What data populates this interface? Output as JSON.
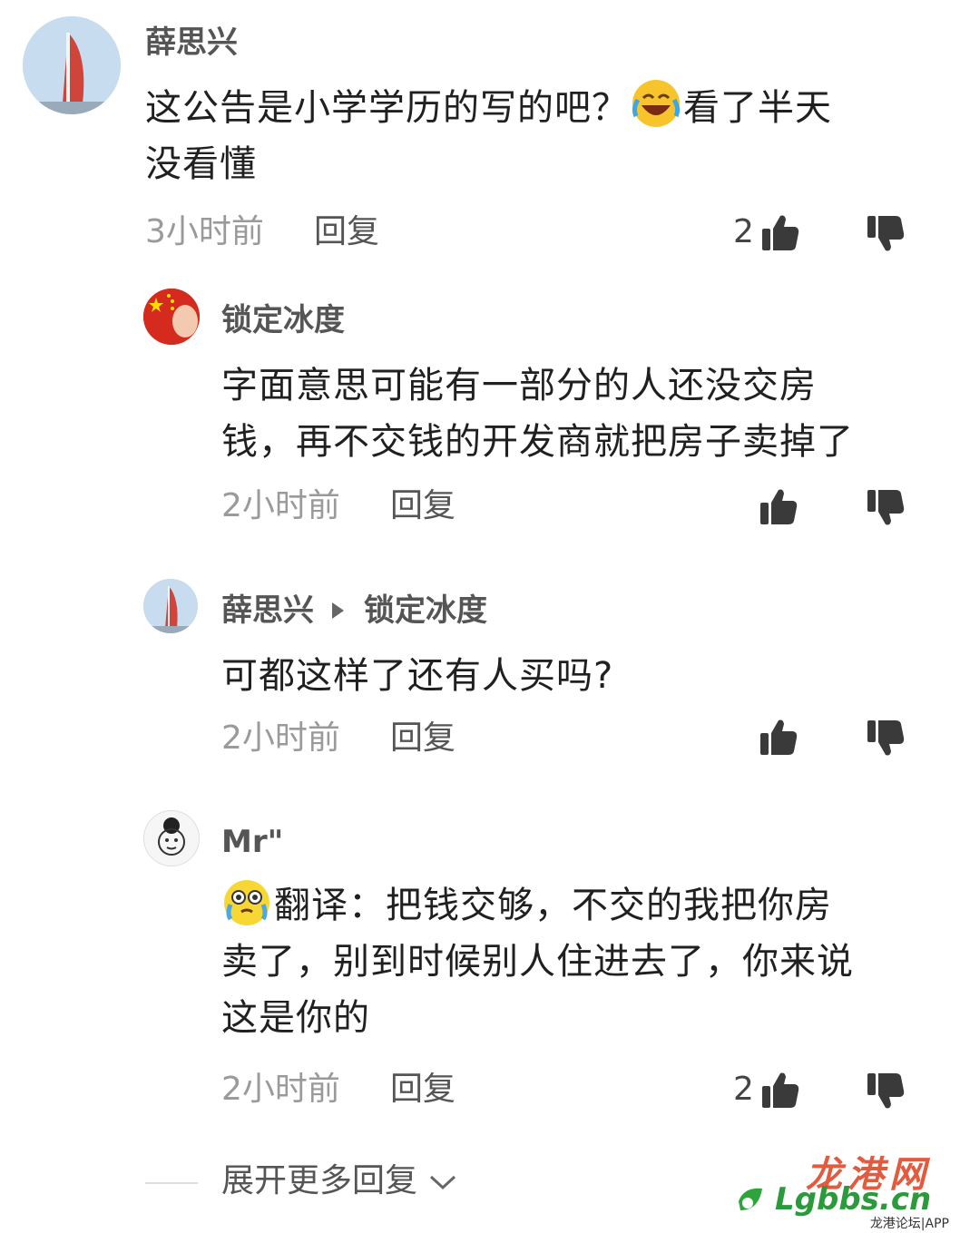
{
  "comments": [
    {
      "username": "薛思兴",
      "reply_to": "",
      "lines": [
        "这公告是小学学历的写的吧？",
        "看了半天",
        "没看懂"
      ],
      "time": "3小时前",
      "reply_label": "回复",
      "likes": "2",
      "avatar": "tower-avatar"
    },
    {
      "username": "锁定冰度",
      "reply_to": "",
      "lines": [
        "字面意思可能有一部分的人还没交房",
        "钱，再不交钱的开发商就把房子卖掉了"
      ],
      "time": "2小时前",
      "reply_label": "回复",
      "likes": "",
      "avatar": "flag-avatar"
    },
    {
      "username": "薛思兴",
      "reply_to": "锁定冰度",
      "lines": [
        "可都这样了还有人买吗?"
      ],
      "time": "2小时前",
      "reply_label": "回复",
      "likes": "",
      "avatar": "tower-avatar"
    },
    {
      "username": "Mr\"",
      "reply_to": "",
      "lines": [
        "翻译：把钱交够，不交的我把你房",
        "卖了，别到时候别人住进去了，你来说",
        "这是你的"
      ],
      "time": "2小时前",
      "reply_label": "回复",
      "likes": "2",
      "avatar": "sketch-avatar"
    }
  ],
  "expand_label": "展开更多回复",
  "watermark": {
    "cn": "龙港网",
    "logo": "Lgbbs.cn",
    "sub": "龙港论坛|APP"
  },
  "icons": [
    "like-icon",
    "dislike-icon",
    "laughing-emoji-icon",
    "crying-emoji-icon",
    "chevron-down-icon",
    "reply-arrow-icon"
  ],
  "colors": {
    "username": "#555555",
    "meta": "#9a9a9a",
    "text": "#202020"
  }
}
